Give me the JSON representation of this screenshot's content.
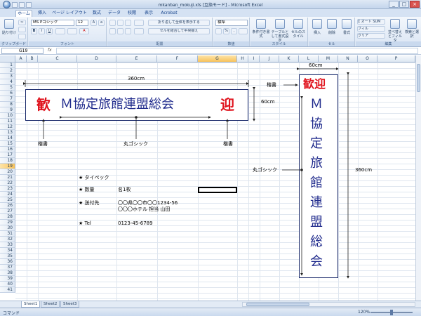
{
  "window": {
    "title": "mkanban_mokuji.xls [互換モード] - Microsoft Excel",
    "buttons": [
      "_",
      "□",
      "×"
    ]
  },
  "ribbon_tabs": [
    "ホーム",
    "挿入",
    "ページ レイアウト",
    "数式",
    "データ",
    "校閲",
    "表示",
    "Acrobat"
  ],
  "ribbon": {
    "clipboard": {
      "paste": "貼り付け",
      "label": "クリップボード"
    },
    "font": {
      "name": "MS Pゴシック",
      "size": "12",
      "label": "フォント"
    },
    "alignment": {
      "wrap": "折り返して全体を表示する",
      "merge": "セルを結合して中央揃え",
      "label": "配置"
    },
    "number": {
      "format": "標準",
      "label": "数値"
    },
    "styles": {
      "conditional": "条件付き書式",
      "table": "テーブルとして書式設定",
      "cellstyle": "セルのスタイル",
      "label": "スタイル"
    },
    "cells": {
      "insert": "挿入",
      "delete": "削除",
      "format": "書式",
      "label": "セル"
    },
    "editing": {
      "autosum": "Σ オート SUM",
      "fill": "フィル",
      "clear": "クリア",
      "sort": "並べ替えとフィルタ",
      "find": "検索と選択",
      "label": "編集"
    }
  },
  "formula_bar": {
    "name_box": "G19",
    "fx": "fx",
    "value": ""
  },
  "columns": [
    "A",
    "B",
    "C",
    "D",
    "E",
    "F",
    "G",
    "H",
    "I",
    "J",
    "K",
    "L",
    "M",
    "N",
    "O",
    "P"
  ],
  "rows": [
    "1",
    "2",
    "3",
    "4",
    "5",
    "6",
    "7",
    "8",
    "9",
    "10",
    "11",
    "12",
    "13",
    "14",
    "15",
    "16",
    "17",
    "18",
    "19",
    "20",
    "21",
    "22",
    "23",
    "24",
    "25",
    "26",
    "27",
    "28",
    "29",
    "30",
    "31",
    "32",
    "33",
    "34",
    "35",
    "36",
    "37",
    "38",
    "39",
    "40",
    "41"
  ],
  "selected": {
    "column": "G",
    "row": "19"
  },
  "sheet": {
    "horizontal_banner": {
      "left_char": "歓",
      "main": "Ｍ協定旅館連盟総会",
      "right_char": "迎",
      "width_label": "360cm",
      "height_label": "60cm",
      "label_left": "楷書",
      "label_center": "丸ゴシック",
      "label_right": "楷書"
    },
    "vertical_banner": {
      "top": "歓迎",
      "chars": [
        "Ｍ",
        "協",
        "定",
        "旅",
        "館",
        "連",
        "盟",
        "総",
        "会"
      ],
      "width_label": "60cm",
      "height_label": "360cm",
      "label_top": "楷書",
      "label_side": "丸ゴシック"
    },
    "info": [
      {
        "label": "★ タイペック",
        "value": ""
      },
      {
        "label": "★ 数量",
        "value": "名1枚"
      },
      {
        "label": "★ 送付先",
        "value": "〇〇県〇〇市〇〇1234-56",
        "value2": "〇〇〇ホテル 担当 山田"
      },
      {
        "label": "★ Tel",
        "value": "0123-45-6789"
      }
    ]
  },
  "sheet_tabs": [
    "Sheet1",
    "Sheet2",
    "Sheet3"
  ],
  "status": {
    "mode": "コマンド",
    "zoom": "120%"
  },
  "colors": {
    "red": "#e0141e",
    "navy": "#1f2a8c",
    "line": "#222222"
  }
}
